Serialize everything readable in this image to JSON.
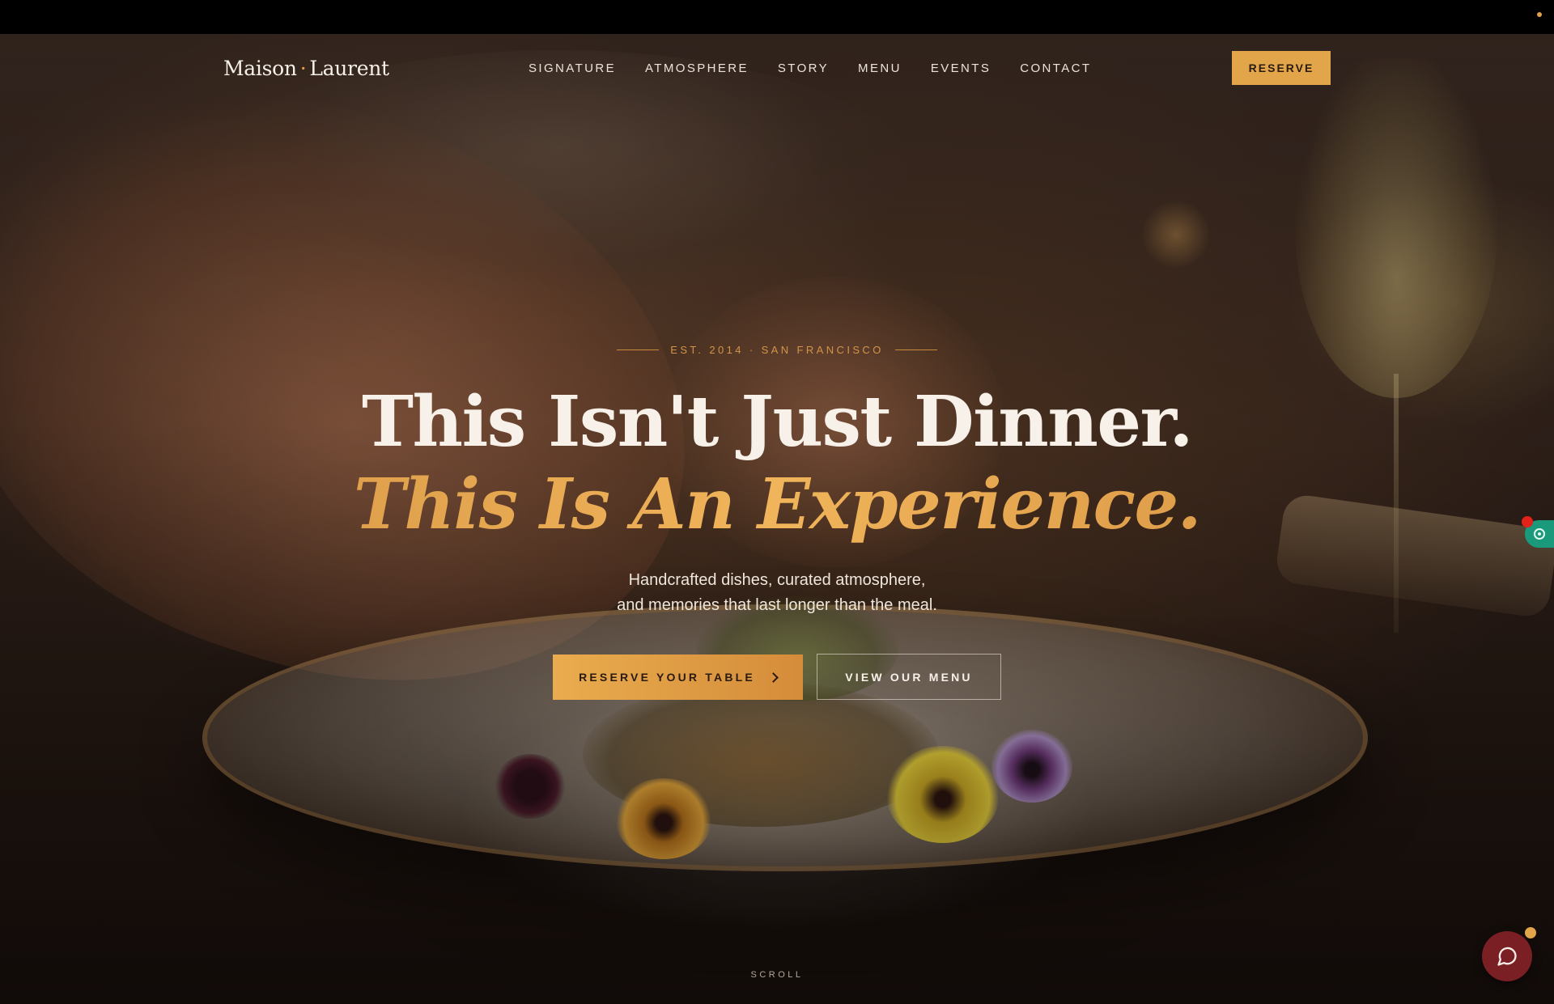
{
  "brand": {
    "name_first": "Maison",
    "separator": "·",
    "name_second": "Laurent",
    "accent_color": "#e2a54a"
  },
  "nav": {
    "links": [
      "SIGNATURE",
      "ATMOSPHERE",
      "STORY",
      "MENU",
      "EVENTS",
      "CONTACT"
    ],
    "reserve_label": "RESERVE"
  },
  "hero": {
    "eyebrow": "EST. 2014 · SAN FRANCISCO",
    "headline_line1": "This Isn't Just Dinner.",
    "headline_line2": "This Is An Experience.",
    "subtext_line1": "Handcrafted dishes, curated atmosphere,",
    "subtext_line2": "and memories that last longer than the meal.",
    "primary_cta": "RESERVE YOUR TABLE",
    "secondary_cta": "VIEW OUR MENU",
    "scroll_label": "SCROLL"
  },
  "widgets": {
    "side_widget_icon": "settings-icon",
    "chat_icon": "chat-bubble-icon",
    "chat_color": "#7a1f24",
    "side_color": "#1a9a7a"
  }
}
